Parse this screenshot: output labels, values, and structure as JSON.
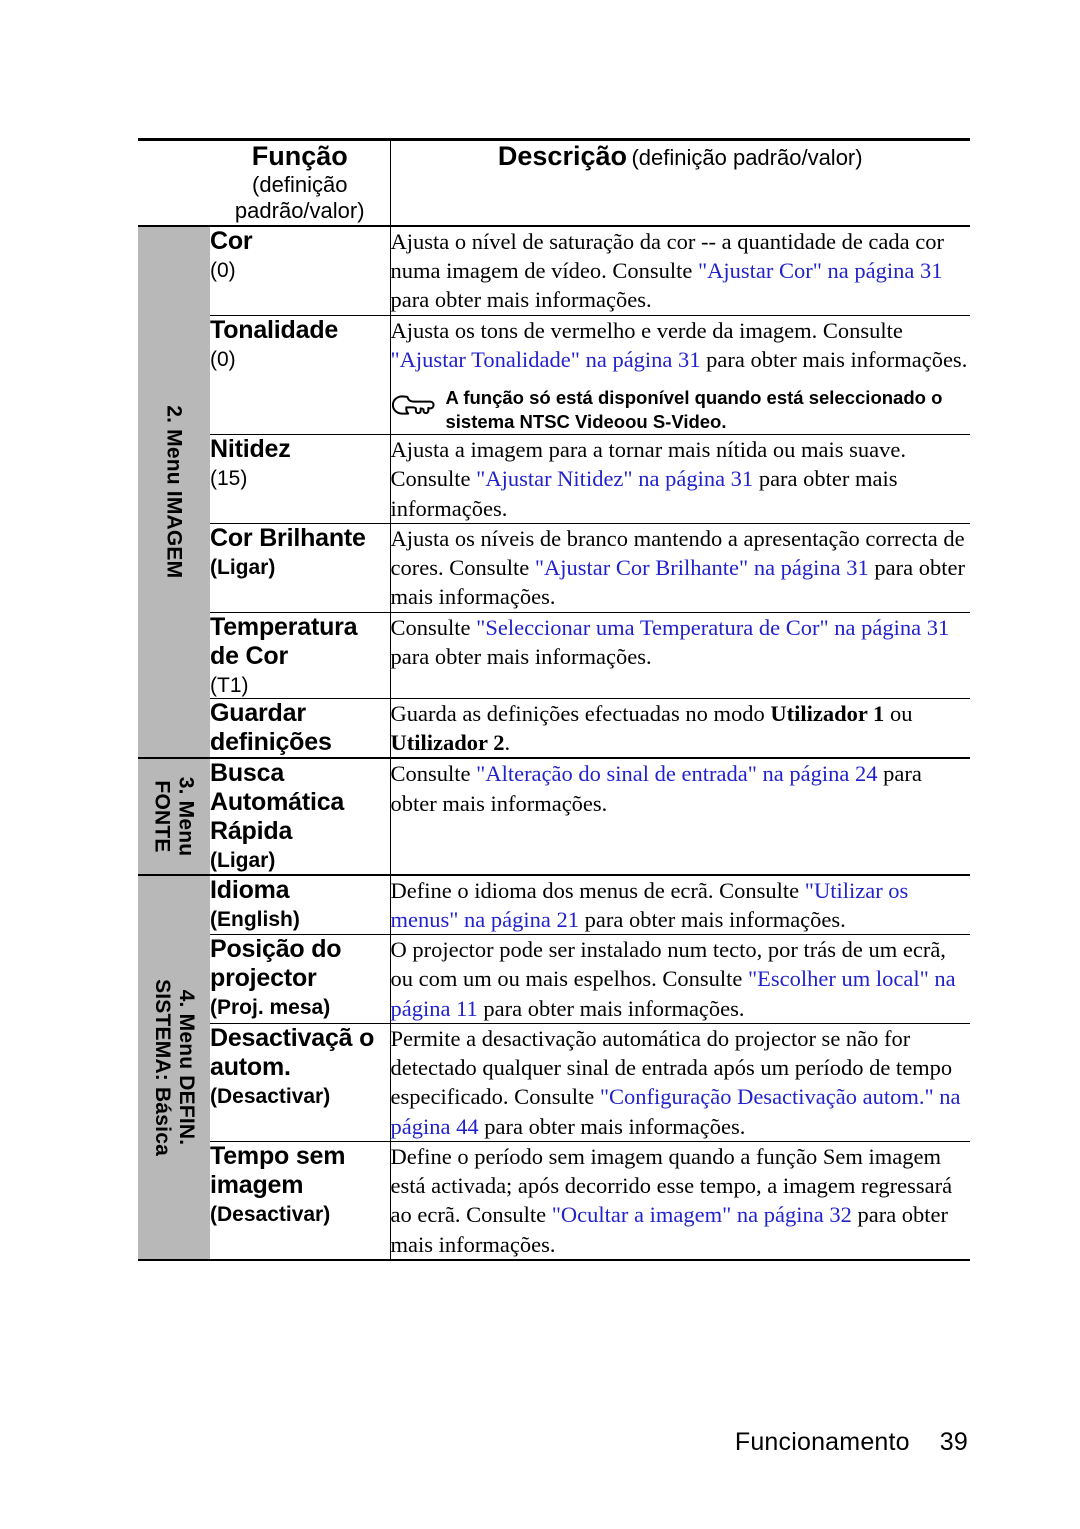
{
  "header": {
    "function_title": "Função",
    "function_sub": "(definição padrão/valor)",
    "description_title": "Descrição",
    "description_sub": "(definição padrão/valor)"
  },
  "colors": {
    "link": "#2222CC",
    "tab_background": "#B8B8B8",
    "rule": "#000000"
  },
  "sections": [
    {
      "tab_lines": [
        "2. Menu IMAGEM"
      ],
      "rows": [
        {
          "name": "Cor",
          "default": "(0)",
          "default_bold": false,
          "desc_parts": [
            {
              "t": "Ajusta o nível de saturação da cor -- a quantidade de cada cor numa imagem de vídeo. Consulte ",
              "style": "plain"
            },
            {
              "t": "\"Ajustar Cor\" na página 31",
              "style": "link"
            },
            {
              "t": " para obter mais informações.",
              "style": "plain"
            }
          ]
        },
        {
          "name": "Tonalidade",
          "default": "(0)",
          "default_bold": false,
          "desc_parts": [
            {
              "t": "Ajusta os tons de vermelho e verde da imagem. Consulte ",
              "style": "plain"
            },
            {
              "t": "\"Ajustar Tonalidade\" na página 31",
              "style": "link"
            },
            {
              "t": " para obter mais informações.",
              "style": "plain"
            }
          ],
          "note": "A função só está disponível quando está seleccionado o sistema NTSC Videoou S-Video."
        },
        {
          "name": "Nitidez",
          "default": "(15)",
          "default_bold": false,
          "desc_parts": [
            {
              "t": "Ajusta a imagem para a tornar mais nítida ou mais suave. Consulte ",
              "style": "plain"
            },
            {
              "t": "\"Ajustar Nitidez\" na página 31",
              "style": "link"
            },
            {
              "t": " para obter mais informações.",
              "style": "plain"
            }
          ]
        },
        {
          "name": "Cor Brilhante",
          "default": "(Ligar)",
          "default_bold": true,
          "desc_parts": [
            {
              "t": "Ajusta os níveis de branco mantendo a apresentação correcta de cores. Consulte ",
              "style": "plain"
            },
            {
              "t": "\"Ajustar Cor Brilhante\" na página 31",
              "style": "link"
            },
            {
              "t": " para obter mais informações.",
              "style": "plain"
            }
          ]
        },
        {
          "name": "Temperatura de Cor",
          "default": "(T1)",
          "default_bold": false,
          "desc_parts": [
            {
              "t": "Consulte ",
              "style": "plain"
            },
            {
              "t": "\"Seleccionar uma Temperatura de Cor\" na página 31",
              "style": "link"
            },
            {
              "t": " para obter mais informações.",
              "style": "plain"
            }
          ]
        },
        {
          "name": "Guardar definições",
          "default": "",
          "default_bold": false,
          "desc_parts": [
            {
              "t": "Guarda as definições efectuadas no modo ",
              "style": "plain"
            },
            {
              "t": "Utilizador 1",
              "style": "bold"
            },
            {
              "t": " ou ",
              "style": "plain"
            },
            {
              "t": "Utilizador 2",
              "style": "bold"
            },
            {
              "t": ".",
              "style": "plain"
            }
          ]
        }
      ]
    },
    {
      "tab_lines": [
        "3. Menu",
        "FONTE"
      ],
      "rows": [
        {
          "name": "Busca Automática Rápida",
          "default": "(Ligar)",
          "default_bold": true,
          "desc_parts": [
            {
              "t": "Consulte ",
              "style": "plain"
            },
            {
              "t": "\"Alteração do sinal de entrada\" na página 24",
              "style": "link"
            },
            {
              "t": " para obter mais informações.",
              "style": "plain"
            }
          ]
        }
      ]
    },
    {
      "tab_lines": [
        "4. Menu DEFIN.",
        "SISTEMA: Básica"
      ],
      "rows": [
        {
          "name": "Idioma",
          "default": "(English)",
          "default_bold": true,
          "desc_parts": [
            {
              "t": "Define o idioma dos menus de ecrã. Consulte ",
              "style": "plain"
            },
            {
              "t": "\"Utilizar os menus\" na página 21",
              "style": "link"
            },
            {
              "t": " para obter mais informações.",
              "style": "plain"
            }
          ]
        },
        {
          "name": "Posição do projector",
          "default": "(Proj. mesa)",
          "default_bold": true,
          "desc_parts": [
            {
              "t": "O projector pode ser instalado num tecto, por trás de um ecrã, ou com um ou mais espelhos. Consulte ",
              "style": "plain"
            },
            {
              "t": "\"Escolher um local\" na página 11",
              "style": "link"
            },
            {
              "t": " para obter mais informações.",
              "style": "plain"
            }
          ]
        },
        {
          "name": "Desactivaçã o autom.",
          "default": "(Desactivar)",
          "default_bold": true,
          "desc_parts": [
            {
              "t": "Permite a desactivação automática do projector se não for detectado qualquer sinal de entrada após um período de tempo especificado. Consulte ",
              "style": "plain"
            },
            {
              "t": "\"Configuração Desactivação autom.\" na página 44",
              "style": "link"
            },
            {
              "t": " para obter mais informações.",
              "style": "plain"
            }
          ]
        },
        {
          "name": "Tempo sem imagem",
          "default": "(Desactivar)",
          "default_bold": true,
          "desc_parts": [
            {
              "t": "Define o período sem imagem quando a função Sem imagem está activada; após decorrido esse tempo, a imagem regressará ao ecrã. Consulte ",
              "style": "plain"
            },
            {
              "t": "\"Ocultar a imagem\" na página 32",
              "style": "link"
            },
            {
              "t": " para obter mais informações.",
              "style": "plain"
            }
          ]
        }
      ]
    }
  ],
  "footer": {
    "chapter": "Funcionamento",
    "page_number": "39"
  },
  "icons": {
    "note": "pointing-hand-icon"
  }
}
